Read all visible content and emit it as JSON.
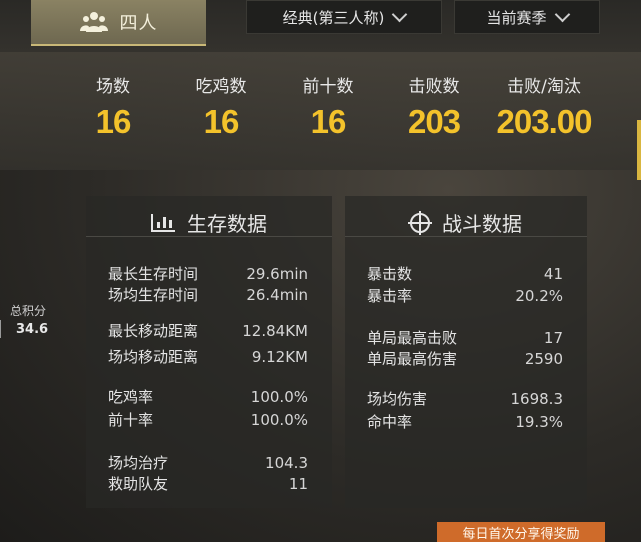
{
  "mode_tab": {
    "label": "四人",
    "icon": "squad-icon"
  },
  "dropdowns": {
    "perspective": "经典(第三人称)",
    "season": "当前赛季"
  },
  "stats": [
    {
      "label": "场数",
      "value": "16"
    },
    {
      "label": "吃鸡数",
      "value": "16"
    },
    {
      "label": "前十数",
      "value": "16"
    },
    {
      "label": "击败数",
      "value": "203"
    },
    {
      "label": "击败/淘汰",
      "value": "203.00"
    }
  ],
  "total_score": {
    "label": "总积分",
    "value": "34.6"
  },
  "survival": {
    "title": "生存数据",
    "icon": "bar-chart-icon",
    "rows": [
      {
        "label": "最长生存时间",
        "value": "29.6min"
      },
      {
        "label": "场均生存时间",
        "value": "26.4min"
      },
      {
        "label": "最长移动距离",
        "value": "12.84KM"
      },
      {
        "label": "场均移动距离",
        "value": "9.12KM"
      },
      {
        "label": "吃鸡率",
        "value": "100.0%"
      },
      {
        "label": "前十率",
        "value": "100.0%"
      },
      {
        "label": "场均治疗",
        "value": "104.3"
      },
      {
        "label": "救助队友",
        "value": "11"
      }
    ]
  },
  "combat": {
    "title": "战斗数据",
    "icon": "crosshair-icon",
    "rows": [
      {
        "label": "暴击数",
        "value": "41"
      },
      {
        "label": "暴击率",
        "value": "20.2%"
      },
      {
        "label": "单局最高击败",
        "value": "17"
      },
      {
        "label": "单局最高伤害",
        "value": "2590"
      },
      {
        "label": "场均伤害",
        "value": "1698.3"
      },
      {
        "label": "命中率",
        "value": "19.3%"
      }
    ]
  },
  "share_banner": "每日首次分享得奖励",
  "colors": {
    "accent": "#f3c22b",
    "banner": "#cf6b2a"
  }
}
